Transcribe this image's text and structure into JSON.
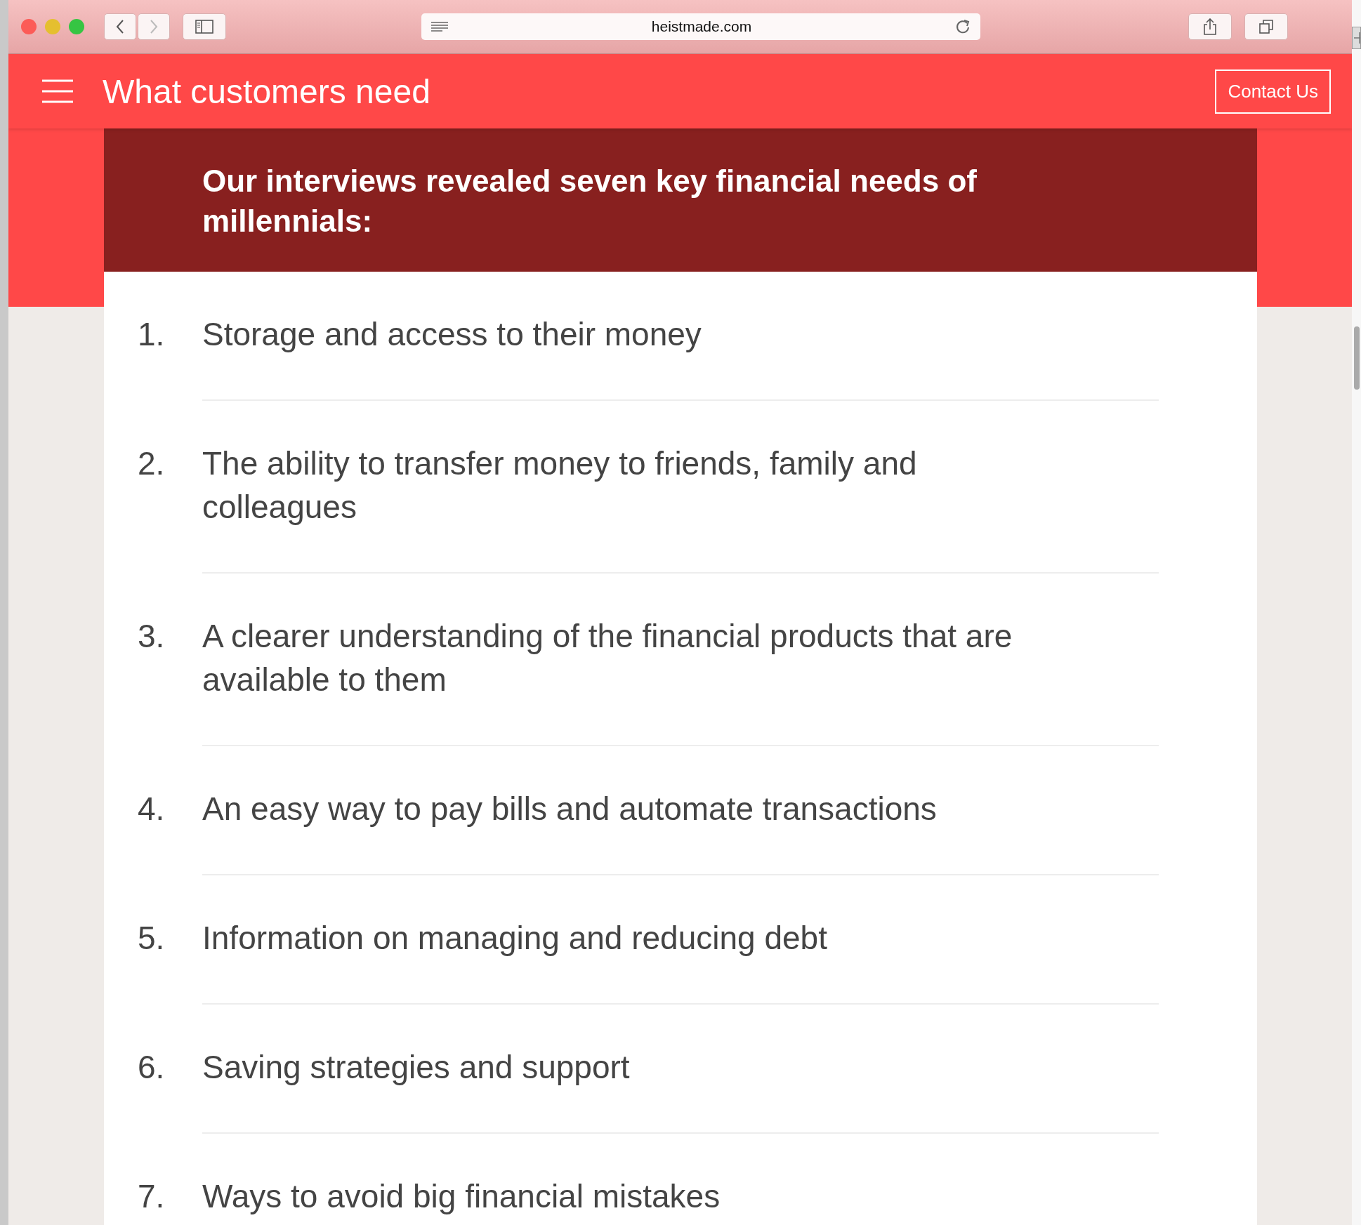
{
  "browser": {
    "url": "heistmade.com"
  },
  "header": {
    "title": "What customers need",
    "button": "Contact Us"
  },
  "card": {
    "heading": "Our interviews revealed seven key financial needs of millennials:",
    "items": [
      {
        "number": "1.",
        "text": "Storage and access to their money"
      },
      {
        "number": "2.",
        "text": "The ability to transfer money to friends, family and colleagues"
      },
      {
        "number": "3.",
        "text": "A clearer understanding of the financial products that are available to them"
      },
      {
        "number": "4.",
        "text": "An easy way to pay bills and automate transactions"
      },
      {
        "number": "5.",
        "text": "Information on managing and reducing debt"
      },
      {
        "number": "6.",
        "text": "Saving strategies and support"
      },
      {
        "number": "7.",
        "text": "Ways to avoid big financial mistakes"
      }
    ]
  }
}
